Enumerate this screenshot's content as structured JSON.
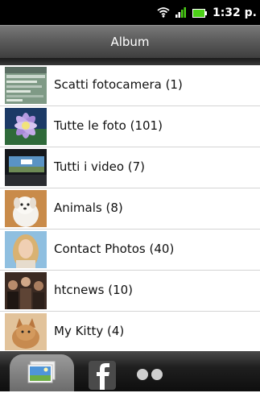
{
  "status_bar": {
    "time": "1:32 p.",
    "icons": [
      "wifi-icon",
      "signal-icon",
      "battery-icon"
    ]
  },
  "header": {
    "title": "Album"
  },
  "albums": [
    {
      "label": "Scatti fotocamera  (1)",
      "thumb": "camera-shot"
    },
    {
      "label": "Tutte le foto  (101)",
      "thumb": "flower"
    },
    {
      "label": "Tutti i video  (7)",
      "thumb": "car-window"
    },
    {
      "label": "Animals  (8)",
      "thumb": "white-dog"
    },
    {
      "label": "Contact Photos  (40)",
      "thumb": "blonde-woman"
    },
    {
      "label": "htcnews  (10)",
      "thumb": "crowd"
    },
    {
      "label": "My Kitty  (4)",
      "thumb": "kitten"
    }
  ],
  "tabs": [
    {
      "name": "gallery",
      "icon": "photo-gallery-icon",
      "selected": true
    },
    {
      "name": "facebook",
      "icon": "facebook-icon",
      "selected": false
    },
    {
      "name": "flickr",
      "icon": "flickr-icon",
      "selected": false
    }
  ],
  "colors": {
    "status_bg": "#000000",
    "title_bar": "#5c5c5c",
    "list_bg": "#ffffff",
    "separator": "#d4d4d4",
    "battery": "#4cd017",
    "flickr_dot": "#cfcfcf"
  }
}
